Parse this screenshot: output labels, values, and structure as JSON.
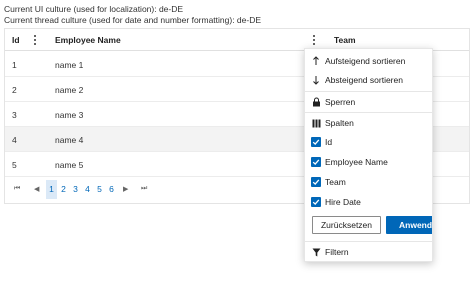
{
  "culture": {
    "ui_line": "Current UI culture (used for localization): de-DE",
    "thread_line": "Current thread culture (used for date and number formatting): de-DE"
  },
  "grid": {
    "columns": {
      "id": "Id",
      "employee_name": "Employee Name",
      "team": "Team"
    },
    "rows": [
      {
        "id": "1",
        "name": "name 1"
      },
      {
        "id": "2",
        "name": "name 2"
      },
      {
        "id": "3",
        "name": "name 3"
      },
      {
        "id": "4",
        "name": "name 4"
      },
      {
        "id": "5",
        "name": "name 5"
      }
    ],
    "pager": {
      "pages": [
        "1",
        "2",
        "3",
        "4",
        "5",
        "6"
      ],
      "current_page": "1",
      "first_icon": "⏮",
      "prev_icon": "◀",
      "next_icon": "▶",
      "last_icon": "⏭"
    }
  },
  "column_menu": {
    "sort_asc": "Aufsteigend sortieren",
    "sort_desc": "Absteigend sortieren",
    "lock": "Sperren",
    "columns": "Spalten",
    "column_options": [
      {
        "label": "Id",
        "checked": true
      },
      {
        "label": "Employee Name",
        "checked": true
      },
      {
        "label": "Team",
        "checked": true
      },
      {
        "label": "Hire Date",
        "checked": true
      }
    ],
    "reset_button": "Zurücksetzen",
    "apply_button": "Anwenden",
    "filter": "Filtern"
  },
  "colors": {
    "accent": "#0067b8",
    "selected_page_bg": "#dbe9f7",
    "alt_row_bg": "#f3f3f3"
  }
}
